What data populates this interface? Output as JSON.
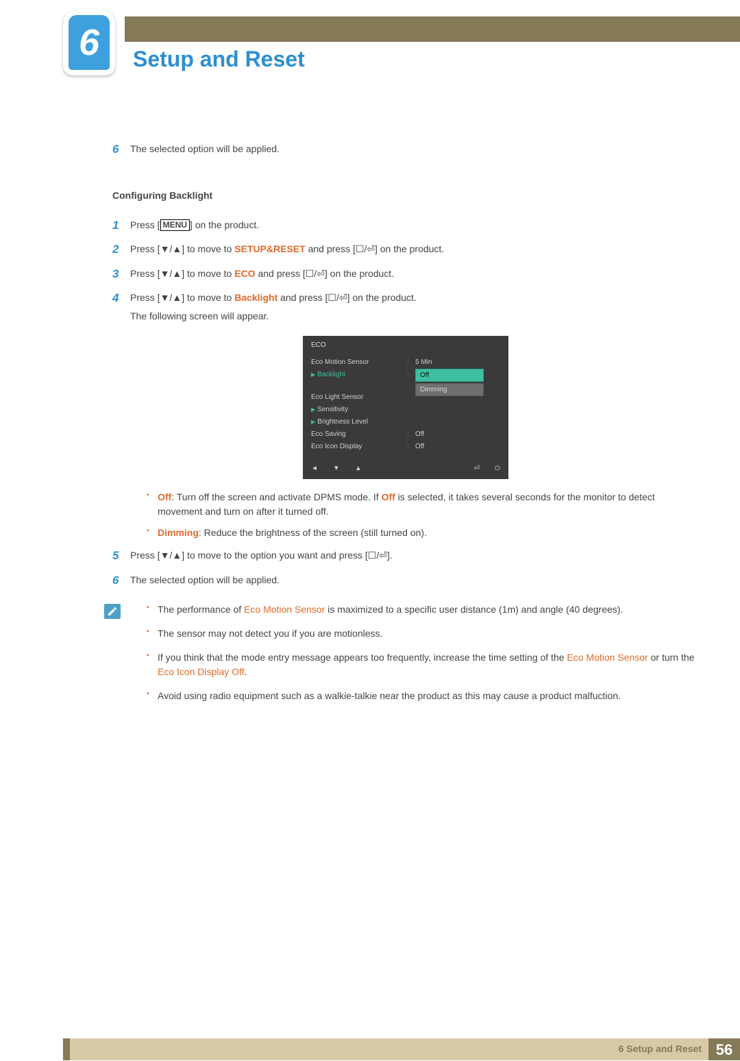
{
  "chapter": {
    "number": "6",
    "title": "Setup and Reset"
  },
  "step6a": {
    "num": "6",
    "text": "The selected option will be applied."
  },
  "section_heading": "Configuring Backlight",
  "steps": {
    "s1": {
      "num": "1",
      "prefix": "Press [",
      "menu": "MENU",
      "suffix": "] on the product."
    },
    "s2": {
      "num": "2",
      "prefix": "Press [",
      "arrows": "▼/▲",
      "mid": "] to move to ",
      "target": "SETUP&RESET",
      "aft": " and press [",
      "enter": "☐/⏎",
      "end": "] on the product."
    },
    "s3": {
      "num": "3",
      "prefix": "Press [",
      "arrows": "▼/▲",
      "mid": "] to move to ",
      "target": "ECO",
      "aft": " and press [",
      "enter": "☐/⏎",
      "end": "] on the product."
    },
    "s4": {
      "num": "4",
      "prefix": "Press [",
      "arrows": "▼/▲",
      "mid": "] to move to ",
      "target": "Backlight",
      "aft": " and press [",
      "enter": "☐/⏎",
      "end": "] on the product.",
      "follow": "The following screen will appear."
    },
    "s5": {
      "num": "5",
      "prefix": "Press [",
      "arrows": "▼/▲",
      "mid": "] to move to the option you want and press [",
      "enter": "☐/⏎",
      "end": "]."
    },
    "s6": {
      "num": "6",
      "text": "The selected option will be applied."
    }
  },
  "osd": {
    "title": "ECO",
    "rows": {
      "r1": {
        "label": "Eco Motion Sensor",
        "val": "5 Min"
      },
      "r2": {
        "label": "Backlight",
        "opt1": "Off",
        "opt2": "Dimming"
      },
      "r3": {
        "label": "Eco Light Sensor"
      },
      "r4": {
        "label": "Sensitivity"
      },
      "r5": {
        "label": "Brightness Level"
      },
      "r6": {
        "label": "Eco Saving",
        "val": "Off"
      },
      "r7": {
        "label": "Eco Icon Display",
        "val": "Off"
      }
    },
    "nav": {
      "l1": "◄",
      "l2": "▼",
      "l3": "▲",
      "r1": "⏎",
      "r2": "⏻"
    }
  },
  "bullets": {
    "b1": {
      "off": "Off",
      "t1": ": Turn off the screen and activate DPMS mode. If ",
      "off2": "Off",
      "t2": " is selected, it takes several seconds for the monitor to detect movement and turn on after it turned off."
    },
    "b2": {
      "dim": "Dimming",
      "t": ": Reduce the brightness of the screen (still turned on)."
    }
  },
  "notes": {
    "n1": {
      "t1": "The performance of ",
      "ems": "Eco Motion Sensor",
      "t2": " is maximized to a specific user distance (1m) and angle (40 degrees)."
    },
    "n2": "The sensor may not detect you if you are motionless.",
    "n3": {
      "t1": "If you think that the mode entry message appears too frequently, increase the time setting of the ",
      "ems": "Eco Motion Sensor",
      "t2": " or turn the ",
      "eid": "Eco Icon Display Off",
      "t3": "."
    },
    "n4": "Avoid using radio equipment such as a walkie-talkie near the product as this may cause a product malfuction."
  },
  "footer": {
    "label_num": "6",
    "label_text": " Setup and Reset",
    "page": "56"
  }
}
